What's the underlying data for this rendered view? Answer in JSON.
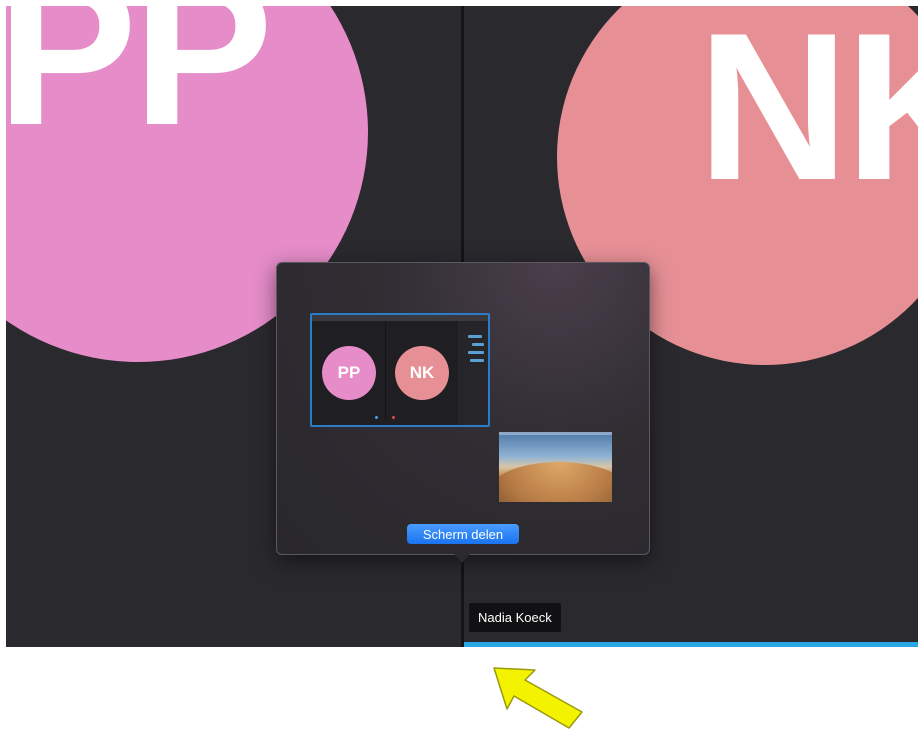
{
  "participants": [
    {
      "initials": "PP",
      "color": "#e58cc9"
    },
    {
      "initials": "NK",
      "color": "#e69096",
      "name": "Nadia Koeck",
      "active_speaker": true
    }
  ],
  "share_popover": {
    "sources": [
      {
        "type": "window",
        "selected": true,
        "avatars": [
          "PP",
          "NK"
        ]
      },
      {
        "type": "desktop",
        "selected": false
      }
    ],
    "share_button_label": "Scherm delen"
  },
  "colors": {
    "background": "#2a292e",
    "active_bar": "#2aa8e6",
    "button": "#1a73f0",
    "arrow": "#f3f300"
  },
  "annotation": {
    "icon": "arrow-pointer-icon"
  }
}
